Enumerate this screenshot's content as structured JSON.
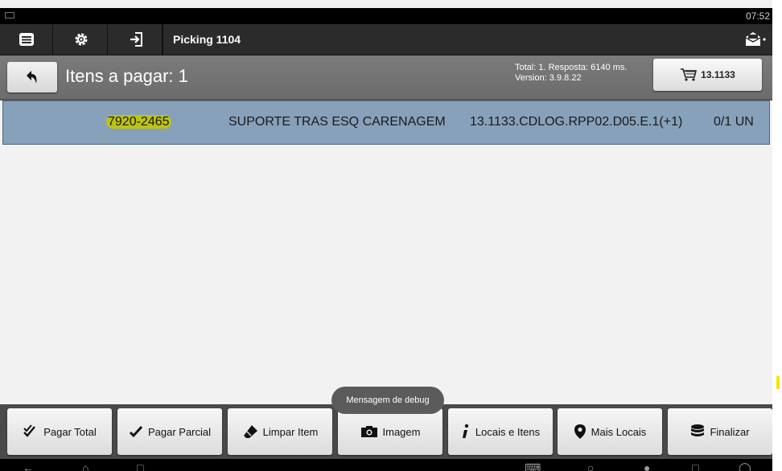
{
  "status_bar": {
    "time": "07:52"
  },
  "top_bar": {
    "title": "Picking 1104",
    "icons": [
      "menu-icon",
      "gear-icon",
      "login-icon",
      "mail-icon"
    ]
  },
  "sub_bar": {
    "title": "Itens a pagar: 1",
    "info_line1": "Total: 1. Resposta: 6140 ms.",
    "info_line2": "Version: 3.9.8.22",
    "cart_label": "13.1133"
  },
  "items": [
    {
      "code": "7920-2465",
      "description": "SUPORTE TRAS ESQ CARENAGEM",
      "location": "13.1133.CDLOG.RPP02.D05.E.1(+1)",
      "quantity": "0/1 UN"
    }
  ],
  "toast": "Mensagem de debug",
  "bottom_buttons": {
    "pagar_total": "Pagar Total",
    "pagar_parcial": "Pagar Parcial",
    "limpar_item": "Limpar Item",
    "imagem": "Imagem",
    "locais_itens": "Locais e Itens",
    "mais_locais": "Mais Locais",
    "finalizar": "Finalizar"
  },
  "colors": {
    "row_selected": "#87a1bb",
    "highlight": "#bcc414",
    "bar_dark": "#2b2b2b"
  }
}
